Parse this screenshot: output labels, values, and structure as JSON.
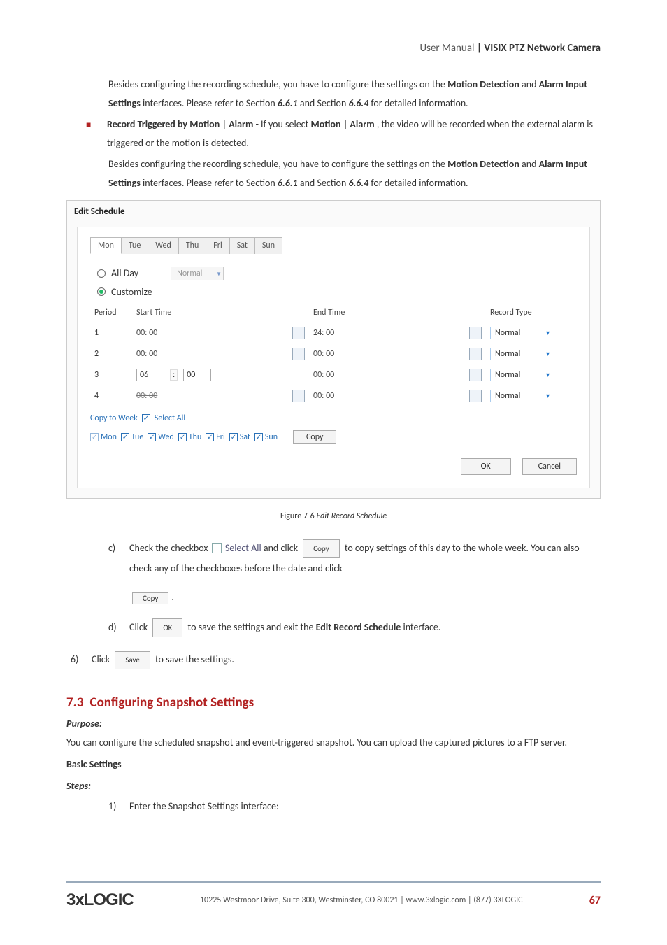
{
  "header": {
    "thin": "User Manual",
    "sep": " | ",
    "bold": "VISIX PTZ Network Camera"
  },
  "p1a": "Besides configuring the recording schedule, you have to configure the settings on the ",
  "p1b": "Motion Detection",
  "p1c": " and ",
  "p1d": "Alarm Input Settings",
  "p1e": " interfaces. Please refer to Section ",
  "p1f": "6.6.1",
  "p1g": " and Section ",
  "p1h": "6.6.4",
  "p1i": " for detailed information",
  "p1j": ".",
  "bullet_head": "Record Triggered by Motion | Alarm - ",
  "bullet_tail1": "If you select ",
  "bullet_bold": "Motion | Alarm",
  "bullet_tail2": ", the video will be recorded when the external alarm is triggered or the motion is detected.",
  "p2a": "Besides configuring the recording schedule, you have to configure the settings on the ",
  "p2b": "Motion Detection",
  "p2c": " and ",
  "p2d": "Alarm Input Settings",
  "p2e": " interfaces. Please refer to Section ",
  "p2f": "6.6.1",
  "p2g": " and Section ",
  "p2h": "6.6.4",
  "p2i": " for detailed information",
  "p2j": ".",
  "edit": {
    "title": "Edit Schedule",
    "tabs": [
      "Mon",
      "Tue",
      "Wed",
      "Thu",
      "Fri",
      "Sat",
      "Sun"
    ],
    "allday": "All Day",
    "customize": "Customize",
    "normal": "Normal",
    "cols": {
      "period": "Period",
      "start": "Start Time",
      "end": "End Time",
      "rtype": "Record Type"
    },
    "rows": [
      {
        "period": "1",
        "start": "00: 00",
        "end": "24: 00",
        "rtype": "Normal"
      },
      {
        "period": "2",
        "start": "00: 00",
        "end": "00: 00",
        "rtype": "Normal"
      },
      {
        "period": "3",
        "start_h": "06",
        "start_m": "00",
        "end": "00: 00",
        "rtype": "Normal"
      },
      {
        "period": "4",
        "start": "00: 00",
        "end": "00: 00",
        "rtype": "Normal"
      }
    ],
    "copyweek": "Copy to Week",
    "selectall": "Select All",
    "days": [
      "Mon",
      "Tue",
      "Wed",
      "Thu",
      "Fri",
      "Sat",
      "Sun"
    ],
    "copy": "Copy",
    "ok": "OK",
    "cancel": "Cancel"
  },
  "figcap_a": "Figure 7-6 ",
  "figcap_b": "Edit Record Schedule",
  "stepc_label": "c)",
  "stepc_1": "Check the checkbox ",
  "stepc_selall": "Select All",
  "stepc_2": "  and click ",
  "stepc_copy": "Copy",
  "stepc_3": " to copy settings of this day to the whole week. You can also check any of the checkboxes before the date and click",
  "copybox_period": ".",
  "stepd_label": "d)",
  "stepd_1": "Click ",
  "stepd_ok": "OK",
  "stepd_2": " to save the settings and exit the ",
  "stepd_bold": "Edit Record Schedule",
  "stepd_3": " interface.",
  "step6n": "6)",
  "step6_1": "Click ",
  "step6_save": "Save",
  "step6_2": " to save the settings.",
  "secnum": "7.3",
  "sectitle": "Configuring Snapshot Settings",
  "purpose": "Purpose:",
  "secbody": "You can configure the scheduled snapshot and event-triggered snapshot. You can upload the captured pictures to a FTP server.",
  "basic": "Basic Settings",
  "steps": "Steps:",
  "sub1n": "1)",
  "sub1t": "Enter the Snapshot Settings interface:",
  "footer": {
    "logo": "3xLOGIC",
    "text": "10225 Westmoor Drive, Suite 300, Westminster, CO 80021 | www.3xlogic.com | (877) 3XLOGIC",
    "page": "67"
  }
}
